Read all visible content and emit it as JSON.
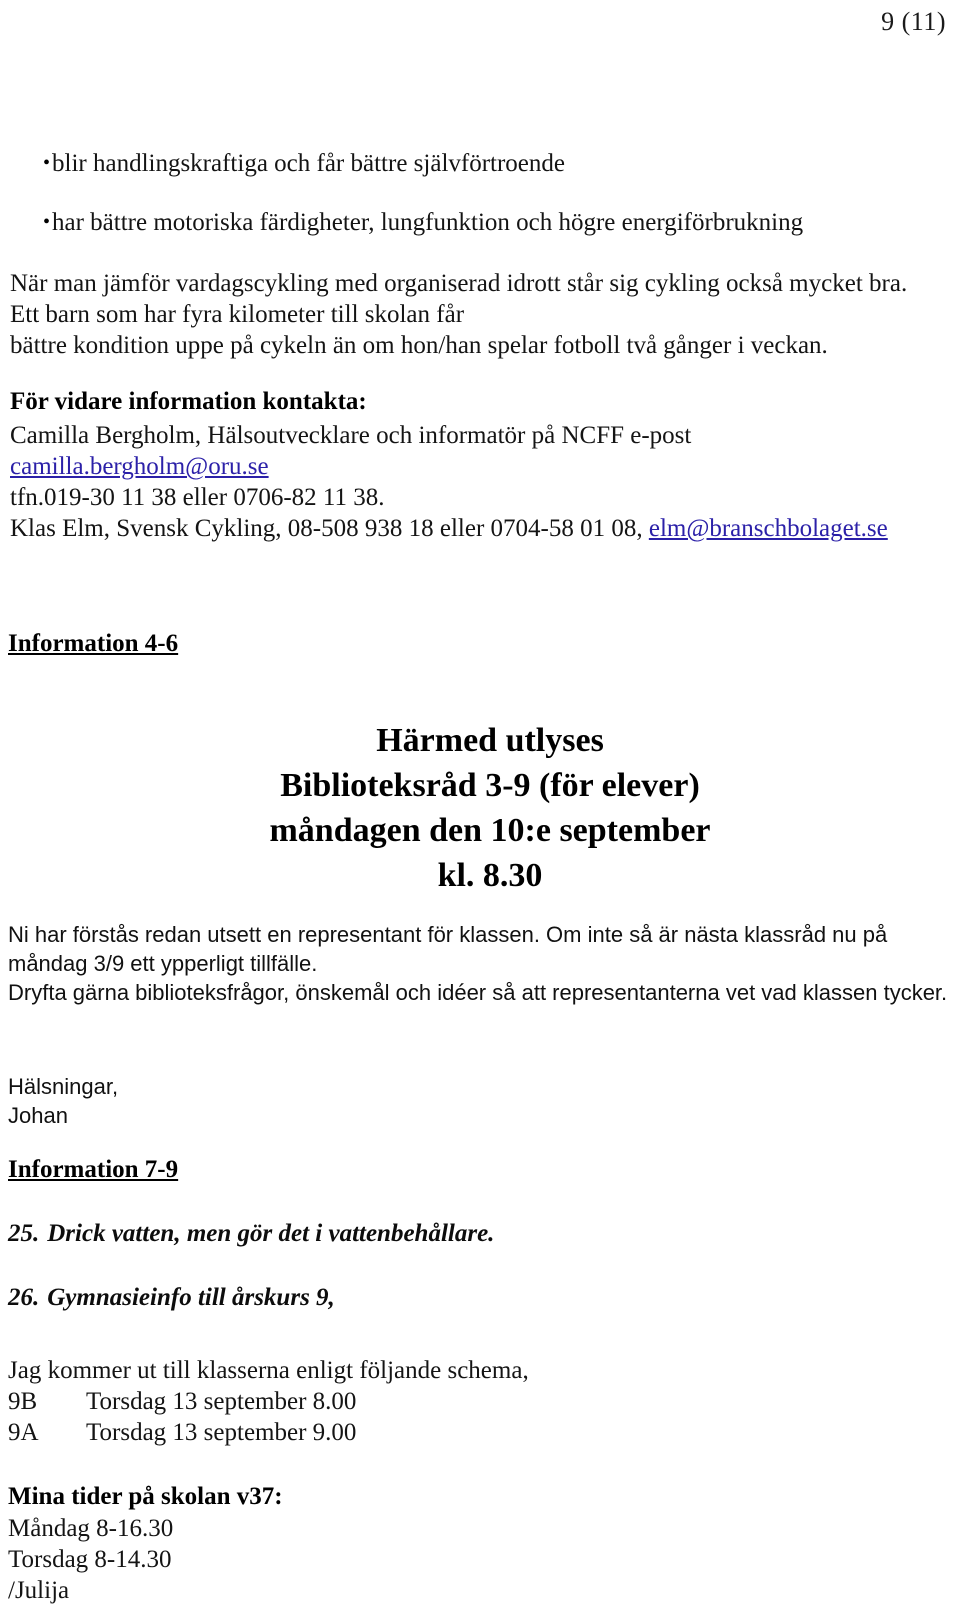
{
  "page": {
    "number_label": "9 (11)"
  },
  "bullets": [
    {
      "glyph": "•",
      "text": "blir handlingskraftiga och får bättre självförtroende"
    },
    {
      "glyph": "•",
      "text": "har bättre motoriska färdigheter, lungfunktion och högre energiförbrukning"
    }
  ],
  "intro_paragraph": {
    "line1": "När man jämför vardagscykling med organiserad idrott står sig cykling också mycket bra.",
    "line2": "Ett barn som har fyra kilometer till skolan får",
    "line3": "bättre kondition uppe på cykeln än om hon/han spelar fotboll två gånger i veckan."
  },
  "contact": {
    "heading": "För vidare information kontakta:",
    "person_line": "Camilla Bergholm, Hälsoutvecklare och informatör på NCFF e-post",
    "email1": "camilla.bergholm@oru.se",
    "phone_line": "tfn.019-30 11 38 eller 0706-82 11 38.",
    "second_person_prefix": "Klas Elm, Svensk Cykling, 08-508 938 18 eller 0704-58 01 08, ",
    "email2": "elm@branschbolaget.se",
    "link_color": "#2b20a8"
  },
  "sections": {
    "info_4_6_heading": "Information 4-6",
    "info_7_9_heading": "Information 7-9"
  },
  "announcement": {
    "line1": "Härmed utlyses",
    "line2": "Biblioteksråd 3-9 (för elever)",
    "line3": "måndagen den 10:e september",
    "line4": "kl. 8.30"
  },
  "sans_paragraph": {
    "line1": "Ni har förstås redan utsett en representant för klassen. Om inte så är nästa klassråd nu på",
    "line2": "måndag 3/9 ett ypperligt tillfälle.",
    "line3": "Dryfta gärna biblioteksfrågor, önskemål och idéer så att representanterna vet vad klassen tycker."
  },
  "signoff": {
    "greeting": "Hälsningar,",
    "name": "Johan"
  },
  "numbered_items": [
    {
      "number": "25.",
      "text": "Drick vatten, men gör det i vattenbehållare."
    },
    {
      "number": "26.",
      "text": "Gymnasieinfo till årskurs 9,"
    }
  ],
  "schedule": {
    "intro": "Jag kommer ut till klasserna enligt följande schema,",
    "rows": [
      {
        "class": "9B",
        "when": "Torsdag 13 september 8.00"
      },
      {
        "class": "9A",
        "when": "Torsdag 13 september 9.00"
      }
    ]
  },
  "hours": {
    "heading": "Mina tider på skolan v37:",
    "line1": "Måndag 8-16.30",
    "line2": "Torsdag 8-14.30",
    "signature": "/Julija"
  }
}
